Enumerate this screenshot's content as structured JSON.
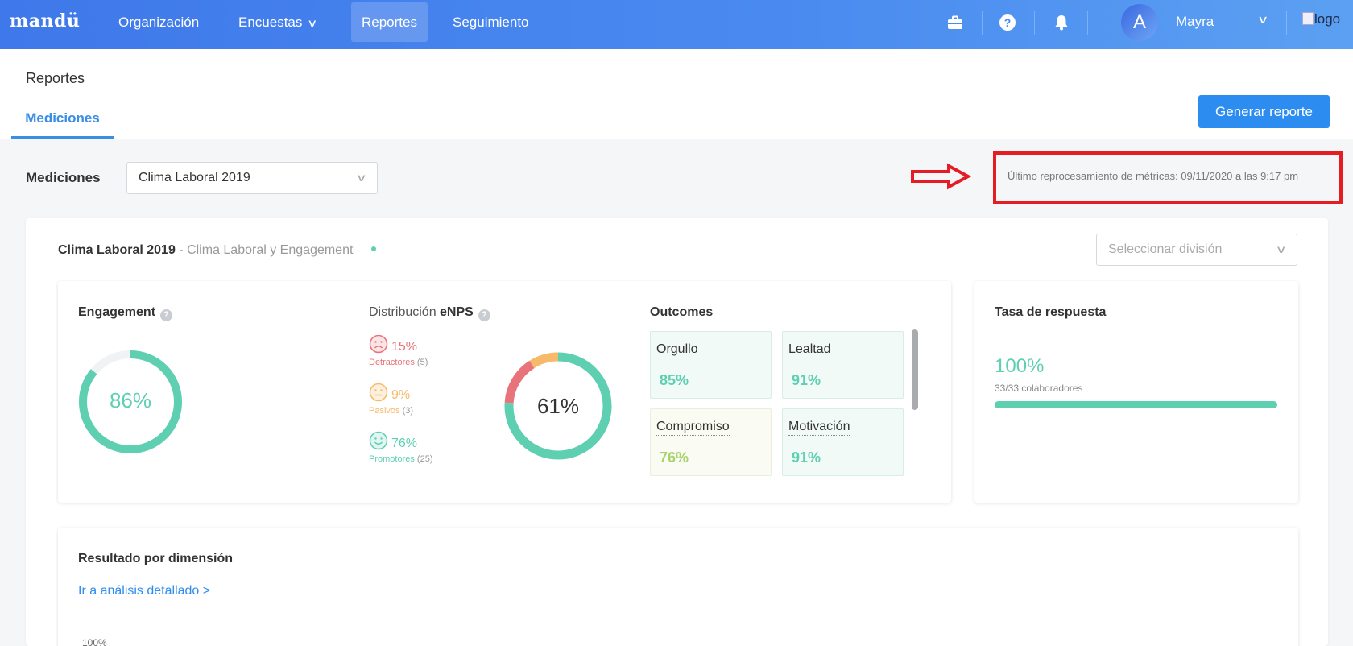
{
  "nav": {
    "brand": "mandü",
    "items": [
      {
        "label": "Organización"
      },
      {
        "label": "Encuestas"
      },
      {
        "label": "Reportes"
      },
      {
        "label": "Seguimiento"
      }
    ],
    "user": {
      "initial": "A",
      "name": "Mayra"
    },
    "logo_alt": "logo"
  },
  "page": {
    "title": "Reportes",
    "tab": "Mediciones",
    "generate_button": "Generar reporte"
  },
  "filters": {
    "mediciones_label": "Mediciones",
    "medicion_selected": "Clima Laboral 2019",
    "reprocess_text": "Último reprocesamiento de métricas: 09/11/2020 a las 9:17 pm",
    "division_placeholder": "Seleccionar división"
  },
  "survey": {
    "name": "Clima Laboral 2019",
    "type": "- Clima Laboral y Engagement"
  },
  "engagement": {
    "title": "Engagement",
    "value_text": "86%",
    "value": 0.86
  },
  "enps": {
    "title_prefix": "Distribución ",
    "title_bold": "eNPS",
    "center_text": "61%",
    "rows": [
      {
        "pct": "15%",
        "label": "Detractores",
        "count": "(5)",
        "value": 0.15
      },
      {
        "pct": "9%",
        "label": "Pasivos",
        "count": "(3)",
        "value": 0.09
      },
      {
        "pct": "76%",
        "label": "Promotores",
        "count": "(25)",
        "value": 0.76
      }
    ]
  },
  "outcomes": {
    "title": "Outcomes",
    "tiles": [
      {
        "name": "Orgullo",
        "value": "85%"
      },
      {
        "name": "Lealtad",
        "value": "91%"
      },
      {
        "name": "Compromiso",
        "value": "76%"
      },
      {
        "name": "Motivación",
        "value": "91%"
      }
    ]
  },
  "response_rate": {
    "title": "Tasa de respuesta",
    "value_text": "100%",
    "detail": "33/33 colaboradores",
    "value": 1.0
  },
  "dimension": {
    "title": "Resultado por dimensión",
    "link": "Ir a análisis detallado >",
    "axis_tick": "100%"
  },
  "colors": {
    "nav_start": "#3f78ea",
    "nav_end": "#5ba0f2",
    "primary": "#2d8cf0",
    "promoter": "#5ecfb1",
    "passive": "#f7b96a",
    "detractor": "#e8737a",
    "annotation": "#e51c23"
  }
}
